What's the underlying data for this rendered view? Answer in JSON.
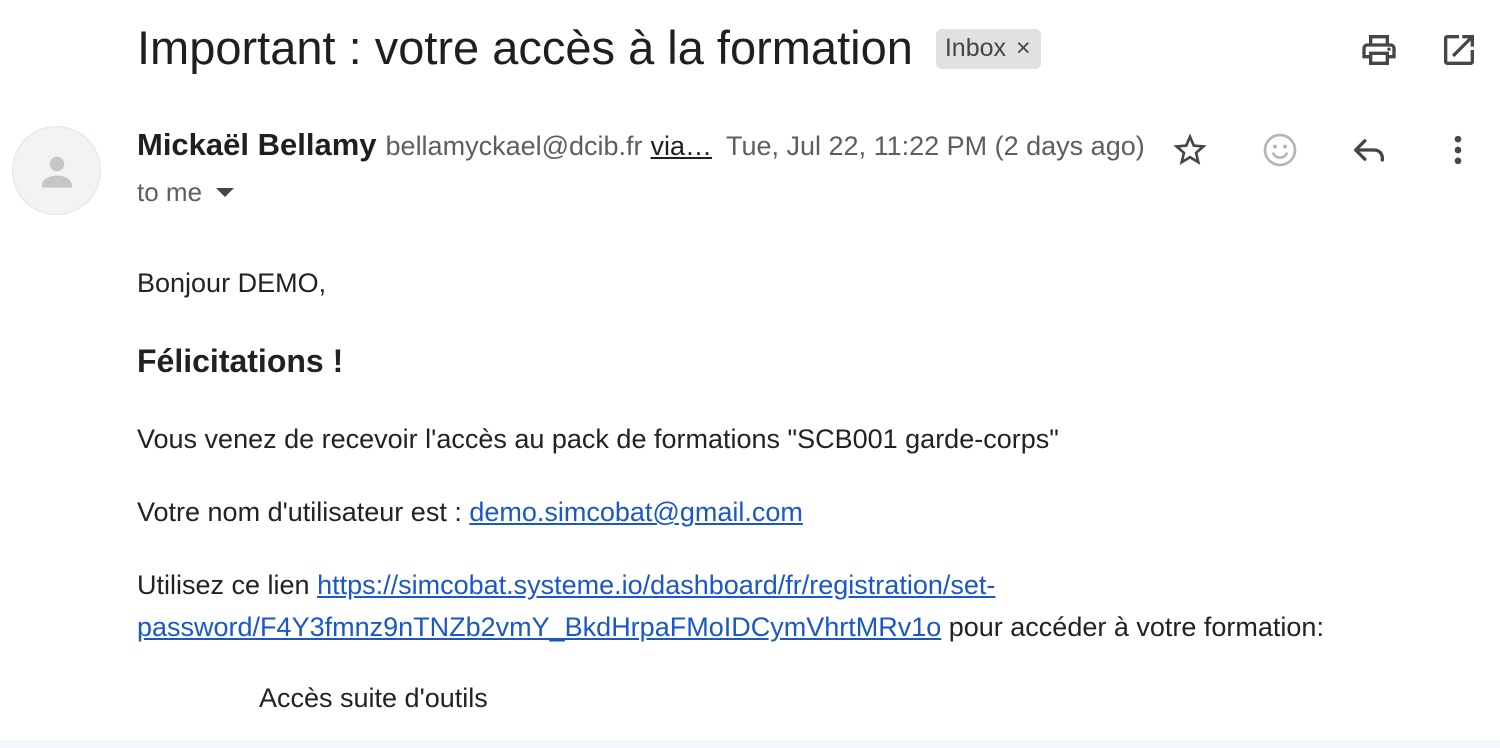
{
  "header": {
    "subject": "Important : votre accès à la formation",
    "label": "Inbox",
    "label_remove": "×",
    "icons": {
      "print": "print-icon",
      "open_new_window": "open-in-new-window-icon"
    }
  },
  "message": {
    "sender_name": "Mickaël Bellamy",
    "sender_email": "bellamyckael@dcib.fr",
    "via": "via…",
    "date": "Tue, Jul 22, 11:22 PM (2 days ago)",
    "recipient": "to me",
    "icons": {
      "avatar": "person-avatar-icon",
      "star": "star-icon",
      "emoji": "emoji-reaction-icon",
      "reply": "reply-icon",
      "more": "more-vertical-icon"
    }
  },
  "body": {
    "greeting": "Bonjour DEMO,",
    "congrats": "Félicitations !",
    "access_text": "Vous venez de recevoir l'accès au pack de formations \"SCB001 garde-corps\"",
    "username_prefix": "Votre nom d'utilisateur est : ",
    "username": "demo.simcobat@gmail.com",
    "link_prefix": "Utilisez ce lien ",
    "link": "https://simcobat.systeme.io/dashboard/fr/registration/set-password/F4Y3fmnz9nTNZb2vmY_BkdHrpaFMoIDCymVhrtMRv1o",
    "link_suffix": " pour accéder à votre formation:",
    "tools_access": "Accès suite d'outils"
  },
  "colors": {
    "link": "#1a57c7",
    "label_bg": "#e1e1e1",
    "secondary_text": "#5e5e5e"
  }
}
